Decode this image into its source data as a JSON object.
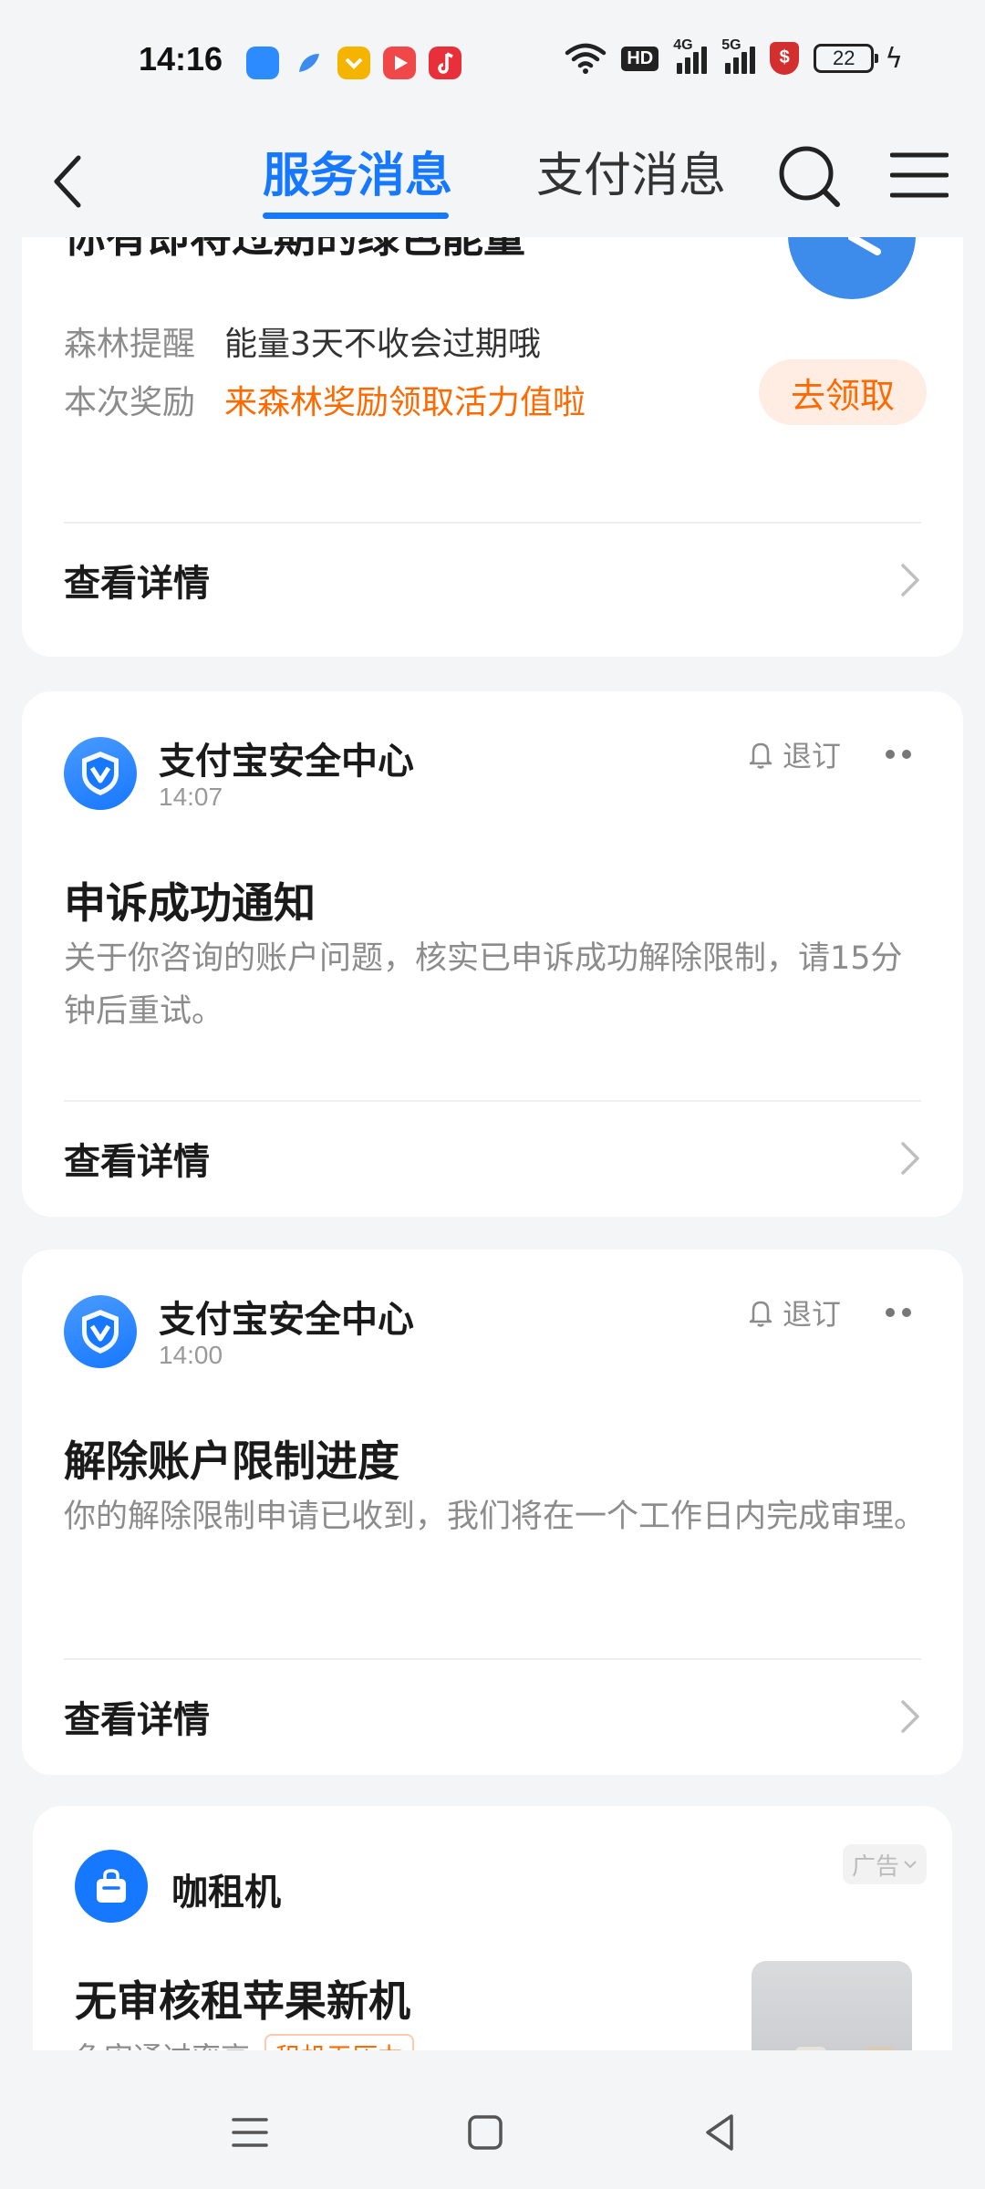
{
  "status_bar": {
    "time": "14:16",
    "hd": "HD",
    "net1": "4G",
    "net2": "5G",
    "battery": "22",
    "app_icons": [
      {
        "name": "blue-app-icon",
        "color": "#2B8BFF"
      },
      {
        "name": "blue-feather-icon",
        "color": "#3C8CF0"
      },
      {
        "name": "yellow-app-icon",
        "color": "#F5B400"
      },
      {
        "name": "video-app-icon",
        "color": "#F04848"
      },
      {
        "name": "music-app-icon",
        "color": "#E8303A"
      }
    ]
  },
  "nav": {
    "tab_service": "服务消息",
    "tab_pay": "支付消息"
  },
  "card1": {
    "title": "你有即将过期的绿色能量",
    "row1_key": "森林提醒",
    "row1_val": "能量3天不收会过期哦",
    "row2_key": "本次奖励",
    "row2_val": "来森林奖励领取活力值啦",
    "claim_label": "去领取",
    "detail_label": "查看详情"
  },
  "messages": [
    {
      "sender": "支付宝安全中心",
      "time": "14:07",
      "unsub_label": "退订",
      "title": "申诉成功通知",
      "body": "关于你咨询的账户问题，核实已申诉成功解除限制，请15分钟后重试。",
      "detail_label": "查看详情"
    },
    {
      "sender": "支付宝安全中心",
      "time": "14:00",
      "unsub_label": "退订",
      "title": "解除账户限制进度",
      "body": "你的解除限制申请已收到，我们将在一个工作日内完成审理。",
      "detail_label": "查看详情"
    }
  ],
  "ad": {
    "name": "咖租机",
    "tag": "广告",
    "title": "无审核租苹果新机",
    "sub": "免审通过率高",
    "pill": "租机无压力"
  },
  "colors": {
    "accent": "#1677FF",
    "orange": "#FF6A00"
  }
}
